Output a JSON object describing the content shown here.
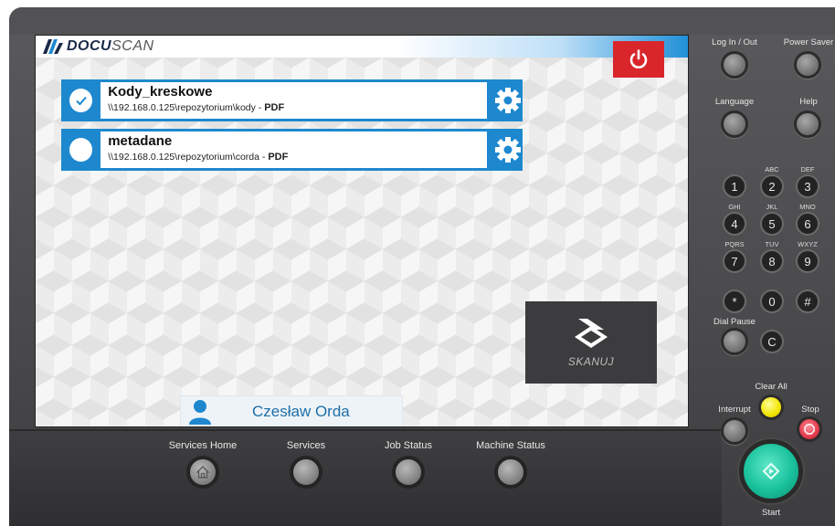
{
  "app": {
    "logo_bold": "DOCU",
    "logo_light": "SCAN"
  },
  "jobs": [
    {
      "name": "Kody_kreskowe",
      "path": "\\\\192.168.0.125\\repozytorium\\kody",
      "separator": " - ",
      "format": "PDF",
      "selected": true
    },
    {
      "name": "metadane",
      "path": "\\\\192.168.0.125\\repozytorium\\corda",
      "separator": " - ",
      "format": "PDF",
      "selected": false
    }
  ],
  "scan": {
    "label": "SKANUJ"
  },
  "user": {
    "name": "Czesław Orda"
  },
  "side_buttons": {
    "login": "Log In / Out",
    "power_saver": "Power Saver",
    "language": "Language",
    "help": "Help",
    "dial_pause": "Dial Pause",
    "clear_all": "Clear All",
    "interrupt": "Interrupt",
    "stop": "Stop",
    "start": "Start"
  },
  "keypad": {
    "keys": [
      "1",
      "2",
      "3",
      "4",
      "5",
      "6",
      "7",
      "8",
      "9",
      "*",
      "0",
      "#",
      "C"
    ],
    "letters": [
      "ABC",
      "DEF",
      "GHI",
      "JKL",
      "MNO",
      "PQRS",
      "TUV",
      "WXYZ"
    ]
  },
  "bottom_buttons": {
    "services_home": "Services Home",
    "services": "Services",
    "job_status": "Job Status",
    "machine_status": "Machine Status"
  },
  "colors": {
    "accent": "#1e88cf",
    "power": "#d9262b",
    "scan_bg": "#3c3c3e",
    "start": "#19c19c",
    "clear": "#f2e600",
    "stop": "#e23a4b"
  }
}
